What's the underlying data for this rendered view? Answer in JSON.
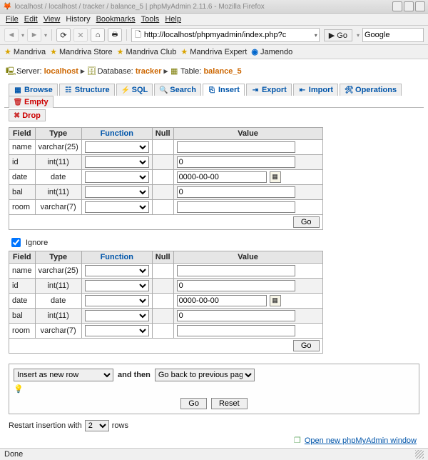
{
  "title": "localhost / localhost / tracker / balance_5 | phpMyAdmin 2.11.6 - Mozilla Firefox",
  "menus": [
    "File",
    "Edit",
    "View",
    "History",
    "Bookmarks",
    "Tools",
    "Help"
  ],
  "url": "http://localhost/phpmyadmin/index.php?c",
  "go_label": "Go",
  "search_engine": "Google",
  "bookmarks": [
    "Mandriva",
    "Mandriva Store",
    "Mandriva Club",
    "Mandriva Expert",
    "Jamendo"
  ],
  "crumb": {
    "server_lbl": "Server:",
    "server": "localhost",
    "db_lbl": "Database:",
    "db": "tracker",
    "tbl_lbl": "Table:",
    "tbl": "balance_5"
  },
  "tabs": [
    "Browse",
    "Structure",
    "SQL",
    "Search",
    "Insert",
    "Export",
    "Import",
    "Operations",
    "Empty"
  ],
  "drop_label": "Drop",
  "headers": {
    "field": "Field",
    "type": "Type",
    "func": "Function",
    "null": "Null",
    "value": "Value"
  },
  "rows": [
    {
      "field": "name",
      "type": "varchar(25)",
      "value": ""
    },
    {
      "field": "id",
      "type": "int(11)",
      "value": "0"
    },
    {
      "field": "date",
      "type": "date",
      "value": "0000-00-00",
      "cal": true
    },
    {
      "field": "bal",
      "type": "int(11)",
      "value": "0"
    },
    {
      "field": "room",
      "type": "varchar(7)",
      "value": ""
    }
  ],
  "go_btn": "Go",
  "ignore": "Ignore",
  "insert_mode": "Insert as new row",
  "and_then": "and then",
  "after": "Go back to previous page",
  "reset": "Reset",
  "restart_pre": "Restart insertion with",
  "restart_val": "2",
  "restart_post": "rows",
  "newwin": "Open new phpMyAdmin window",
  "status": "Done"
}
